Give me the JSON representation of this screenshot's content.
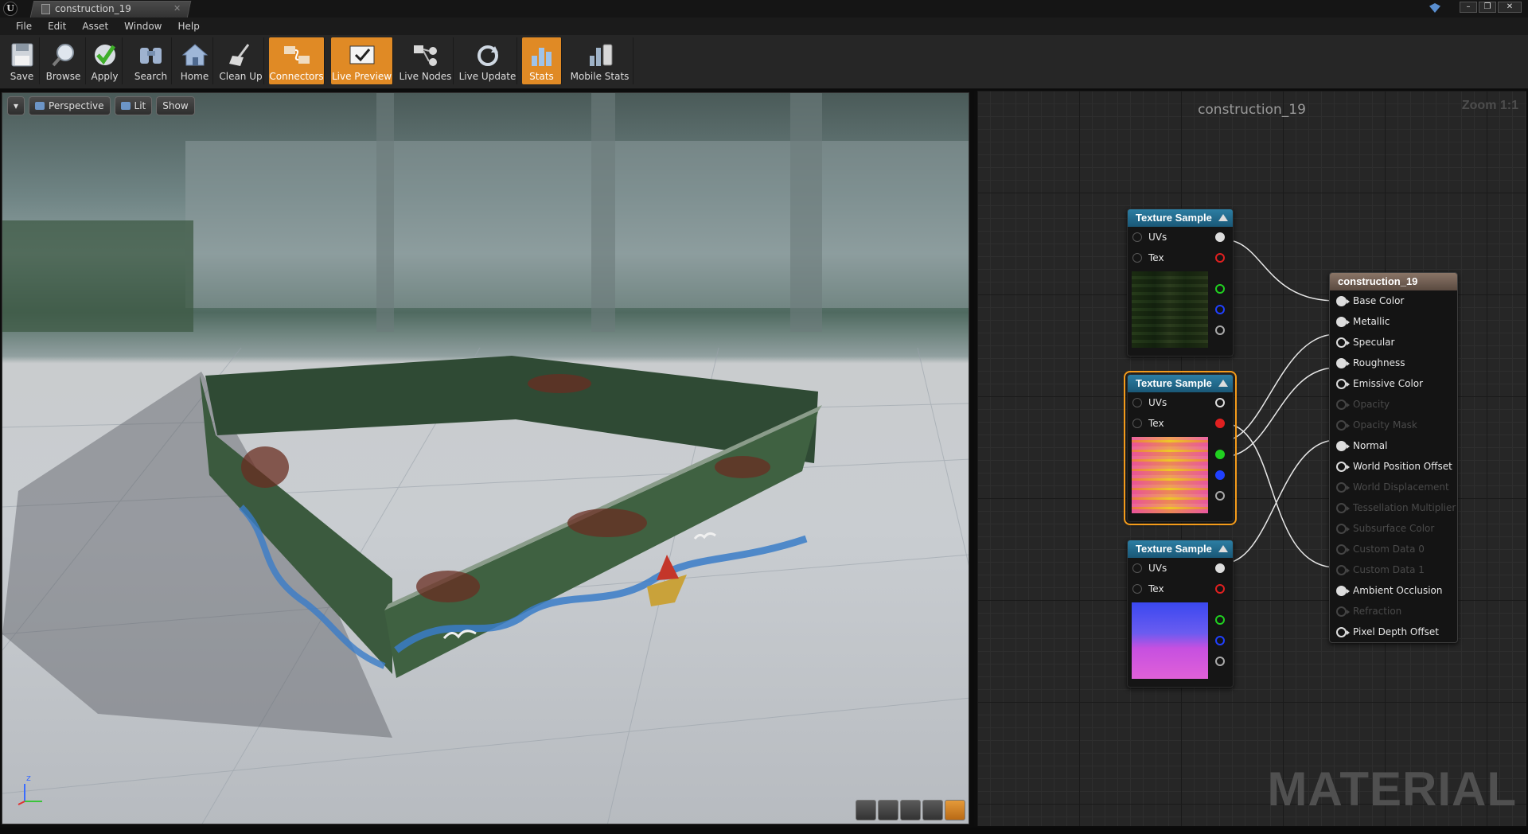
{
  "window": {
    "doc_tab": "construction_19",
    "logo_letter": "U",
    "controls": [
      "–",
      "❐",
      "✕"
    ]
  },
  "menu": [
    "File",
    "Edit",
    "Asset",
    "Window",
    "Help"
  ],
  "toolbar": {
    "buttons": [
      {
        "label": "Save",
        "icon": "save-icon",
        "active": false
      },
      {
        "label": "Browse",
        "icon": "browse-icon",
        "active": false
      },
      {
        "label": "Apply",
        "icon": "apply-check-icon",
        "active": false
      },
      {
        "label": "Search",
        "icon": "search-binoculars-icon",
        "active": false
      },
      {
        "label": "Home",
        "icon": "home-icon",
        "active": false
      },
      {
        "label": "Clean Up",
        "icon": "broom-icon",
        "active": false
      },
      {
        "label": "Connectors",
        "icon": "connectors-icon",
        "active": true
      },
      {
        "label": "Live Preview",
        "icon": "live-preview-icon",
        "active": true
      },
      {
        "label": "Live Nodes",
        "icon": "live-nodes-icon",
        "active": false
      },
      {
        "label": "Live Update",
        "icon": "live-update-icon",
        "active": false
      },
      {
        "label": "Stats",
        "icon": "stats-icon",
        "active": true
      },
      {
        "label": "Mobile Stats",
        "icon": "mobile-stats-icon",
        "active": false
      }
    ]
  },
  "viewport": {
    "dropdown": "▾",
    "perspective": "Perspective",
    "lit": "Lit",
    "show": "Show",
    "axis_z": "z"
  },
  "graph": {
    "title": "construction_19",
    "zoom": "Zoom 1:1",
    "watermark": "MATERIAL",
    "texture_nodes": [
      {
        "title": "Texture Sample",
        "inputs": [
          "UVs",
          "Tex"
        ],
        "selected": false
      },
      {
        "title": "Texture Sample",
        "inputs": [
          "UVs",
          "Tex"
        ],
        "selected": true
      },
      {
        "title": "Texture Sample",
        "inputs": [
          "UVs",
          "Tex"
        ],
        "selected": false
      }
    ],
    "result_node": {
      "title": "construction_19",
      "pins": [
        {
          "label": "Base Color",
          "enabled": true,
          "connected": true
        },
        {
          "label": "Metallic",
          "enabled": true,
          "connected": true
        },
        {
          "label": "Specular",
          "enabled": true,
          "connected": false
        },
        {
          "label": "Roughness",
          "enabled": true,
          "connected": true
        },
        {
          "label": "Emissive Color",
          "enabled": true,
          "connected": false
        },
        {
          "label": "Opacity",
          "enabled": false,
          "connected": false
        },
        {
          "label": "Opacity Mask",
          "enabled": false,
          "connected": false
        },
        {
          "label": "Normal",
          "enabled": true,
          "connected": true
        },
        {
          "label": "World Position Offset",
          "enabled": true,
          "connected": false
        },
        {
          "label": "World Displacement",
          "enabled": false,
          "connected": false
        },
        {
          "label": "Tessellation Multiplier",
          "enabled": false,
          "connected": false
        },
        {
          "label": "Subsurface Color",
          "enabled": false,
          "connected": false
        },
        {
          "label": "Custom Data 0",
          "enabled": false,
          "connected": false
        },
        {
          "label": "Custom Data 1",
          "enabled": false,
          "connected": false
        },
        {
          "label": "Ambient Occlusion",
          "enabled": true,
          "connected": true
        },
        {
          "label": "Refraction",
          "enabled": false,
          "connected": false
        },
        {
          "label": "Pixel Depth Offset",
          "enabled": true,
          "connected": false
        }
      ]
    }
  },
  "colors": {
    "accent": "#e08a25",
    "node_header": "#2c7ea3",
    "result_header": "#8a7567",
    "pin_red": "#e02020",
    "pin_green": "#20d020",
    "pin_blue": "#2040ff"
  }
}
